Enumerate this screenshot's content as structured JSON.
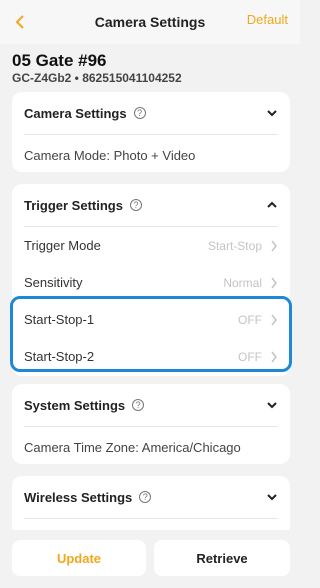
{
  "header": {
    "title": "Camera Settings",
    "default_label": "Default"
  },
  "device": {
    "name": "05 Gate #96",
    "subtitle": "GC-Z4Gb2 • 862515041104252"
  },
  "camera_settings": {
    "label": "Camera Settings",
    "mode_text": "Camera Mode: Photo + Video"
  },
  "trigger_settings": {
    "label": "Trigger Settings",
    "rows": [
      {
        "label": "Trigger Mode",
        "value": "Start-Stop"
      },
      {
        "label": "Sensitivity",
        "value": "Normal"
      },
      {
        "label": "Start-Stop-1",
        "value": "OFF"
      },
      {
        "label": "Start-Stop-2",
        "value": "OFF"
      }
    ]
  },
  "system_settings": {
    "label": "System Settings",
    "timezone_text": "Camera Time Zone: America/Chicago"
  },
  "wireless_settings": {
    "label": "Wireless Settings"
  },
  "help_glyph": "?",
  "footer": {
    "update_label": "Update",
    "retrieve_label": "Retrieve"
  },
  "colors": {
    "accent": "#f0a81c",
    "highlight": "#1e88d8",
    "background": "#f2f2f2"
  }
}
